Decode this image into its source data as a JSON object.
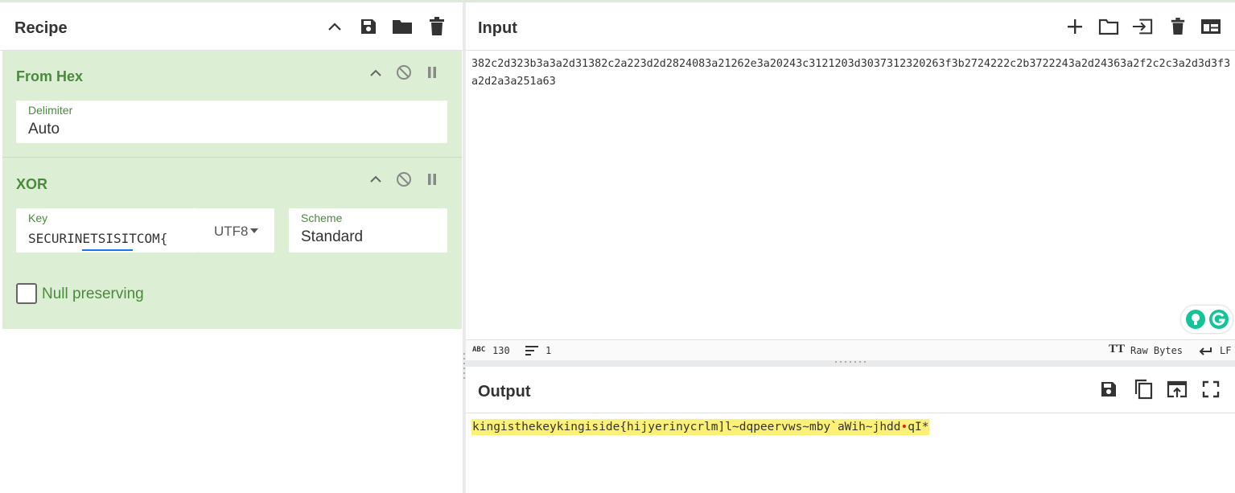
{
  "recipe": {
    "title": "Recipe",
    "operations": [
      {
        "name": "From Hex",
        "fields": {
          "delimiter_label": "Delimiter",
          "delimiter_value": "Auto"
        }
      },
      {
        "name": "XOR",
        "fields": {
          "key_label": "Key",
          "key_value": "SECURINETSISITCOM{",
          "key_encoding": "UTF8",
          "scheme_label": "Scheme",
          "scheme_value": "Standard",
          "null_preserving_label": "Null preserving",
          "null_preserving_checked": false
        }
      }
    ]
  },
  "input": {
    "title": "Input",
    "text": "382c2d323b3a3a2d31382c2a223d2d2824083a21262e3a20243c3121203d3037312320263f3b2724222c2b3722243a2d24363a2f2c2c3a2d3d3f3a2d2a3a251a63",
    "status": {
      "length": "130",
      "lines": "1",
      "encoding": "Raw Bytes",
      "eol": "LF"
    }
  },
  "output": {
    "title": "Output",
    "text_before": "kingisthekeykingiside{hijyerinycrlm]l~dqpeervws~mby`aWih~jhdd",
    "text_after": "qI*",
    "highlight_color": "#fbf176"
  },
  "colors": {
    "op_bg": "#dcefd5",
    "op_title": "#4a8a3c",
    "accent": "#1a73e8"
  }
}
